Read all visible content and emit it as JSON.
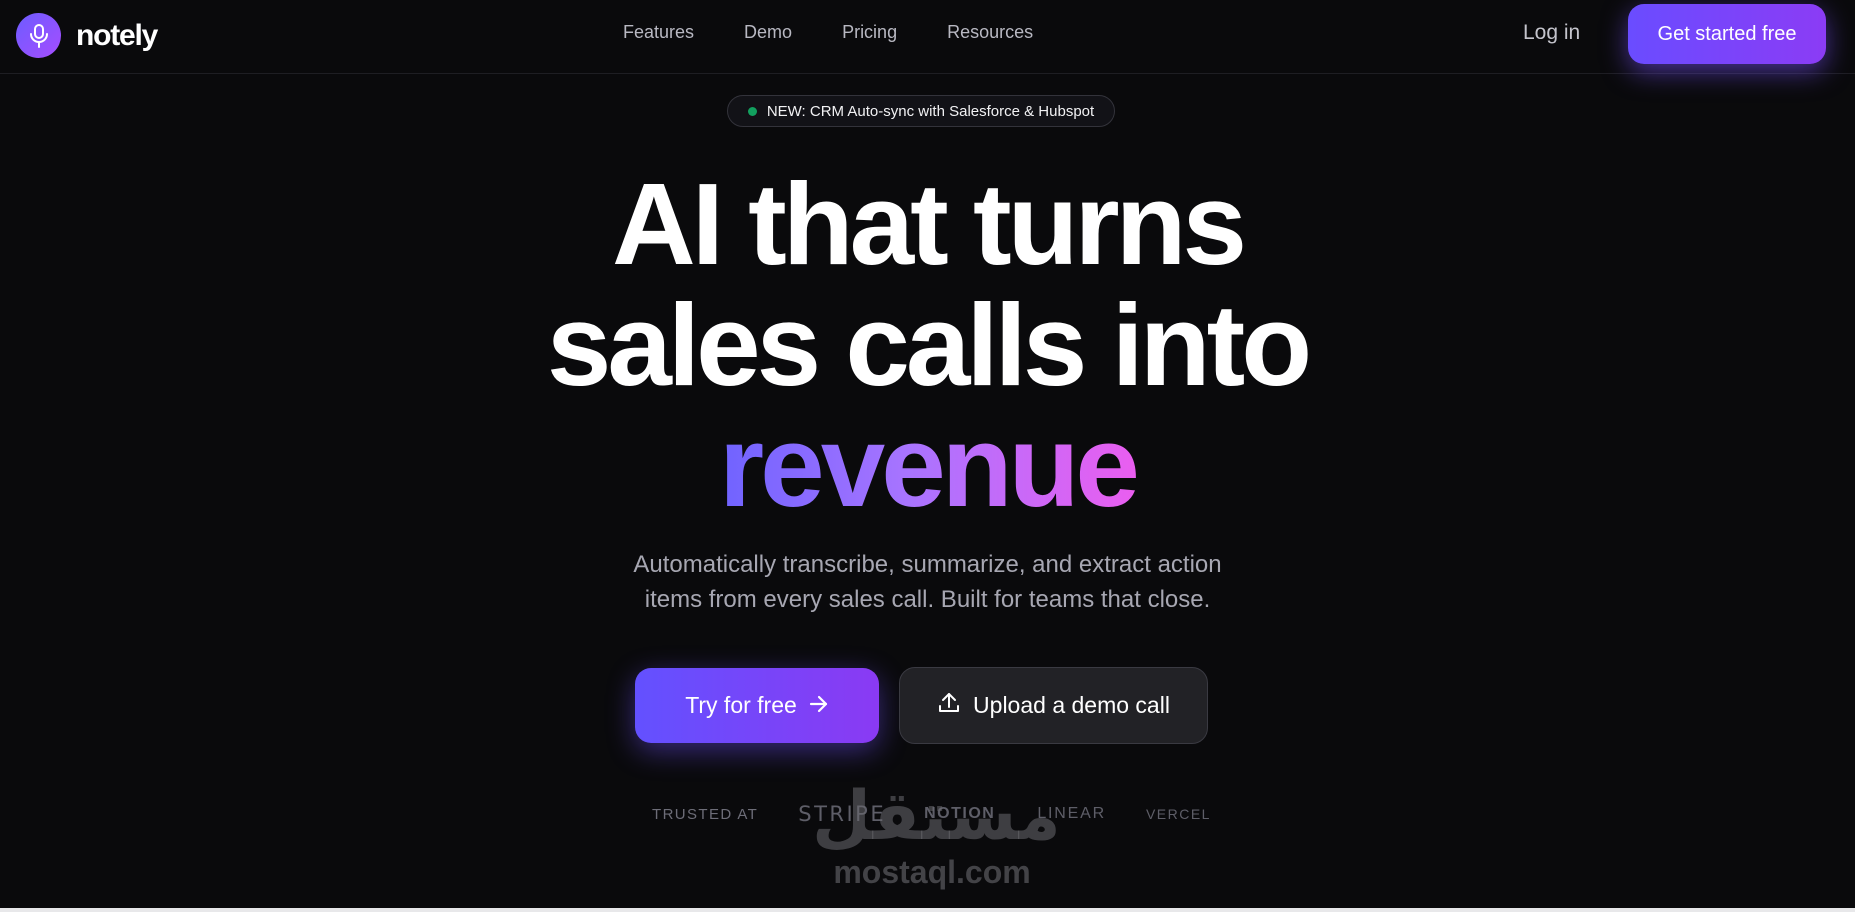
{
  "header": {
    "logo_icon": "microphone-icon",
    "brand": "notely",
    "nav": [
      {
        "label": "Features"
      },
      {
        "label": "Demo"
      },
      {
        "label": "Pricing"
      },
      {
        "label": "Resources"
      }
    ],
    "login_label": "Log in",
    "cta_label": "Get started free"
  },
  "announcement": {
    "dot_color": "#12a05f",
    "text": "NEW: CRM Auto-sync with Salesforce & Hubspot"
  },
  "hero": {
    "line1": "AI that turns",
    "line2": "sales calls into",
    "accent": "revenue",
    "accent_gradient": [
      "#6f63ff",
      "#a874ff",
      "#ea5ef0"
    ],
    "subtitle_line1": "Automatically transcribe, summarize, and extract action",
    "subtitle_line2": "items from every sales call. Built for teams that close."
  },
  "actions": {
    "primary_label": "Try for free",
    "primary_icon": "arrow-right-icon",
    "secondary_label": "Upload a demo call",
    "secondary_icon": "upload-icon"
  },
  "trusted": {
    "label": "TRUSTED AT",
    "brands": [
      "STRIPE",
      "NOTION",
      "LINEAR",
      "VERCEL"
    ]
  },
  "watermark": {
    "arabic": "مستقل",
    "latin": "mostaql.com"
  },
  "colors": {
    "background": "#0a0a0c",
    "accent_start": "#6a4cff",
    "accent_end": "#8b3cf5"
  }
}
